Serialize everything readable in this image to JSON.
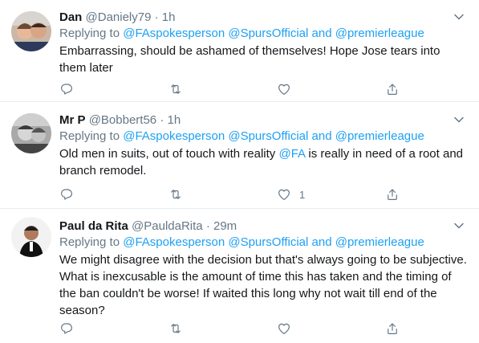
{
  "tweets": [
    {
      "name": "Dan",
      "handle": "@Daniely79",
      "sep": "·",
      "time": "1h",
      "replying_prefix": "Replying to",
      "mention1": "@FAspokesperson",
      "mention2": "@SpursOfficial",
      "and_word": "and",
      "mention3": "@premierleague",
      "text": "Embarrassing, should be ashamed of themselves! Hope Jose tears into them later",
      "like_count": ""
    },
    {
      "name": "Mr P",
      "handle": "@Bobbert56",
      "sep": "·",
      "time": "1h",
      "replying_prefix": "Replying to",
      "mention1": "@FAspokesperson",
      "mention2": "@SpursOfficial",
      "and_word": "and",
      "mention3": "@premierleague",
      "text_before": "Old men in suits, out of touch with reality ",
      "text_mention": "@FA",
      "text_after": " is really in need of a root and branch remodel.",
      "like_count": "1"
    },
    {
      "name": "Paul da Rita",
      "handle": "@PauldaRita",
      "sep": "·",
      "time": "29m",
      "replying_prefix": "Replying to",
      "mention1": "@FAspokesperson",
      "mention2": "@SpursOfficial",
      "and_word": "and",
      "mention3": "@premierleague",
      "text": "We might disagree with the decision  but that's always going to be subjective. What is inexcusable is the amount of time this has taken and the timing of the ban couldn't be worse! If waited this long why not wait till end of the season?",
      "like_count": ""
    }
  ],
  "icons": [
    "reply-icon",
    "retweet-icon",
    "like-icon",
    "share-icon",
    "chevron-down-icon"
  ],
  "colors": {
    "link": "#1da1f2",
    "muted": "#657786",
    "text": "#14171a",
    "divider": "#e6ecf0"
  }
}
